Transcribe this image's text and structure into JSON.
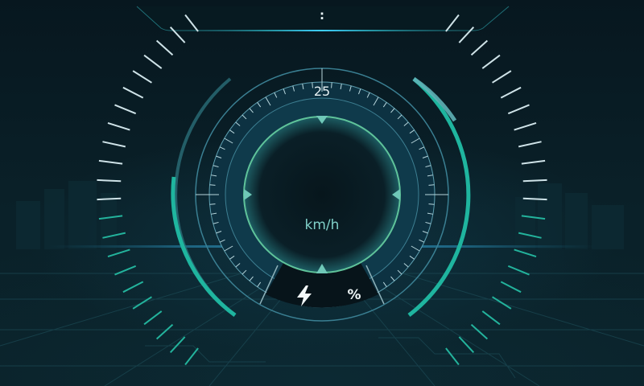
{
  "status_bar": {
    "clock_text": ":"
  },
  "speedometer": {
    "top_scale_label": "25",
    "unit_label": "km/h",
    "needle_markers": [
      "up-triangle-icon",
      "down-triangle-icon",
      "left-triangle-icon",
      "right-triangle-icon"
    ]
  },
  "battery": {
    "icon": "lightning-bolt-icon",
    "percent_suffix": "%"
  },
  "side_gauges": {
    "left_ticks": 22,
    "right_ticks": 22
  },
  "colors": {
    "accent": "#1fb59f",
    "accent_bright": "#3fd8c0",
    "ring": "#5d9fb0",
    "background": "#06141b",
    "dial_fill": "#0e3444"
  }
}
